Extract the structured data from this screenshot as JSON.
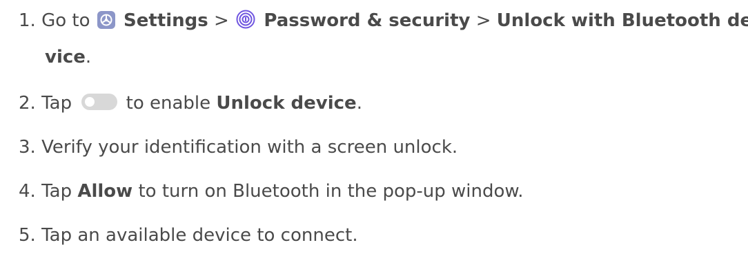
{
  "steps": [
    {
      "number": "1.",
      "text_go_to": "Go to",
      "settings_label": "Settings",
      "sep1": ">",
      "password_label": "Password & security",
      "sep2": ">",
      "bt_label_line1": "Unlock with Bluetooth de-",
      "bt_label_line2": "vice",
      "period": "."
    },
    {
      "number": "2.",
      "text_tap": "Tap",
      "text_to_enable": "to enable",
      "unlock_device_label": "Unlock device",
      "period": "."
    },
    {
      "number": "3.",
      "text": "Verify your identification with a screen unlock."
    },
    {
      "number": "4.",
      "text_tap": "Tap",
      "allow_label": "Allow",
      "text_rest": "to turn on Bluetooth in the pop-up window."
    },
    {
      "number": "5.",
      "text": "Tap an available device to connect."
    }
  ],
  "icons": {
    "settings": "settings-icon",
    "password": "fingerprint-icon",
    "toggle": "toggle-switch-icon"
  },
  "colors": {
    "text": "#4a4a4a",
    "settings_icon_bg": "#8c96c8",
    "fingerprint": "#6f55e0",
    "toggle_track": "#d8d8d8"
  }
}
